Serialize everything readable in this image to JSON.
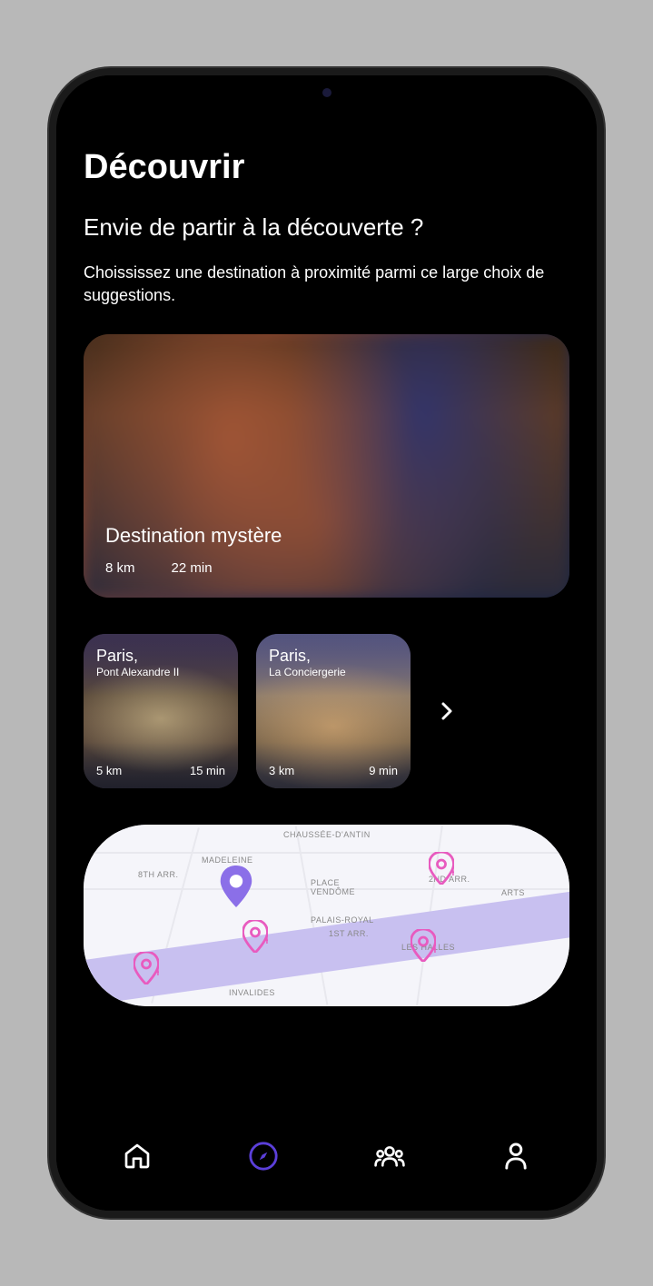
{
  "header": {
    "title": "Découvrir",
    "subtitle": "Envie de partir à la découverte ?",
    "description": "Choississez une destination à proximité parmi ce large choix de suggestions."
  },
  "hero": {
    "title": "Destination mystère",
    "distance": "8 km",
    "duration": "22 min"
  },
  "cards": [
    {
      "city": "Paris,",
      "place": "Pont Alexandre II",
      "distance": "5 km",
      "duration": "15 min"
    },
    {
      "city": "Paris,",
      "place": "La Conciergerie",
      "distance": "3 km",
      "duration": "9 min"
    }
  ],
  "map": {
    "labels": [
      "CHAUSSÉE-D'ANTIN",
      "MADELEINE",
      "8TH ARR.",
      "PLACE VENDÔME",
      "2ND ARR.",
      "ARTS",
      "PALAIS-ROYAL",
      "1ST ARR.",
      "LES HALLES",
      "INVALIDES"
    ]
  },
  "colors": {
    "accent": "#5b3fd9",
    "pin": "#e85bbf"
  }
}
